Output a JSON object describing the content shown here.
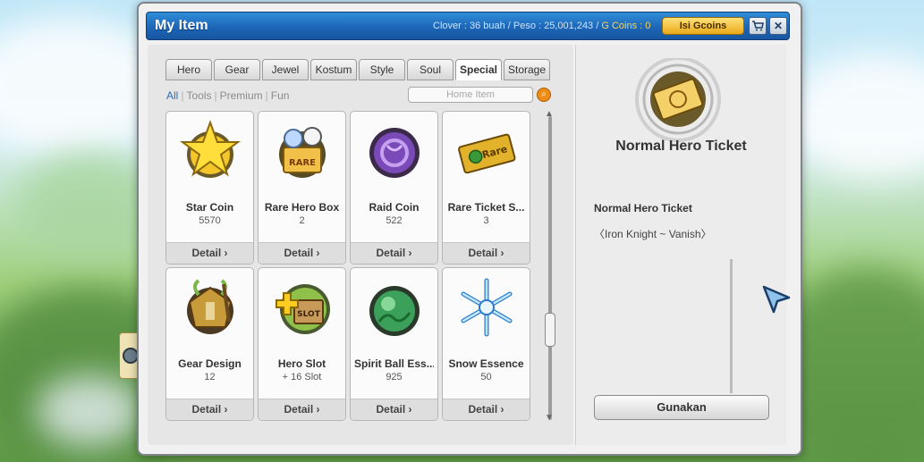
{
  "window": {
    "title": "My Item",
    "currency_text": "Clover : 36 buah  /  Peso : 25,001,243  /",
    "gcoins_text": "G Coins : 0",
    "isi_gcoins_label": "Isi Gcoins",
    "cart_icon": "cart-icon",
    "close_icon": "close-icon"
  },
  "tabs": [
    {
      "label": "Hero"
    },
    {
      "label": "Gear"
    },
    {
      "label": "Jewel"
    },
    {
      "label": "Kostum"
    },
    {
      "label": "Style"
    },
    {
      "label": "Soul"
    },
    {
      "label": "Special",
      "active": true
    },
    {
      "label": "Storage"
    }
  ],
  "filters": [
    {
      "label": "All",
      "active": true
    },
    {
      "label": "Tools"
    },
    {
      "label": "Premium"
    },
    {
      "label": "Fun"
    }
  ],
  "search": {
    "placeholder": "Home Item"
  },
  "items": [
    {
      "name": "Star Coin",
      "qty": "5570",
      "detail": "Detail ›",
      "icon": "star-coin-icon"
    },
    {
      "name": "Rare Hero Box",
      "qty": "2",
      "detail": "Detail ›",
      "icon": "rare-hero-box-icon"
    },
    {
      "name": "Raid Coin",
      "qty": "522",
      "detail": "Detail ›",
      "icon": "raid-coin-icon"
    },
    {
      "name": "Rare Ticket S...",
      "qty": "3",
      "detail": "Detail ›",
      "icon": "rare-ticket-icon"
    },
    {
      "name": "Gear Design",
      "qty": "12",
      "detail": "Detail ›",
      "icon": "gear-design-icon"
    },
    {
      "name": "Hero Slot",
      "qty": "+ 16 Slot",
      "detail": "Detail ›",
      "icon": "hero-slot-icon"
    },
    {
      "name": "Spirit Ball Ess...",
      "qty": "925",
      "detail": "Detail ›",
      "icon": "spirit-ball-icon"
    },
    {
      "name": "Snow Essence",
      "qty": "50",
      "detail": "Detail ›",
      "icon": "snow-essence-icon"
    }
  ],
  "detail_panel": {
    "title": "Normal Hero Ticket",
    "subtitle": "Normal Hero Ticket",
    "description": "〈Iron Knight ~ Vanish〉",
    "use_label": "Gunakan",
    "icon": "hero-ticket-icon"
  },
  "colors": {
    "title_bar": "#1d66b8",
    "gcoins": "#ffd54a",
    "isi_button": "#e9a918"
  }
}
